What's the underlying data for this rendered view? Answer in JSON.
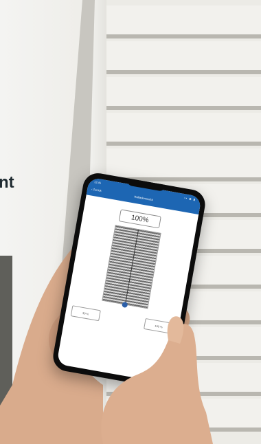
{
  "headline_fragment": "nt",
  "app": {
    "status_time": "12:45",
    "status_icons": "▪▪ ◉ ▮",
    "back_label": "‹ Zurück",
    "title": "Rollladenmodul",
    "position_display": "100%",
    "position_fraction": 1.0,
    "buttons": [
      "30 %",
      "100 %"
    ]
  },
  "colors": {
    "app_bar": "#1d66b3",
    "knob": "#2c5fa8",
    "slat_dark": "#6d6d6d"
  }
}
